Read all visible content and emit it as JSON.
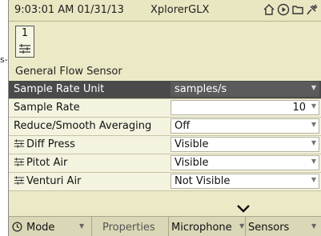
{
  "status_bar": {
    "time": "9:03:01 AM 01/31/13",
    "app_title": "XplorerGLX",
    "icons": [
      "home-icon",
      "play-icon",
      "folder-icon",
      "power-plug-icon"
    ]
  },
  "side_mark": "s-",
  "sensor": {
    "channel": "1",
    "icon": "flow-sensor-icon",
    "name": "General Flow Sensor"
  },
  "properties": [
    {
      "label": "Sample Rate Unit",
      "value": "samples/s",
      "selected": true
    },
    {
      "label": "Sample Rate",
      "value": "10",
      "align": "right"
    },
    {
      "label": "Reduce/Smooth Averaging",
      "value": "Off"
    },
    {
      "label": "Diff Press",
      "value": "Visible",
      "icon": "flow-sensor-icon"
    },
    {
      "label": "Pitot Air",
      "value": "Visible",
      "icon": "flow-sensor-icon"
    },
    {
      "label": "Venturi Air",
      "value": "Not Visible",
      "icon": "flow-sensor-icon"
    }
  ],
  "scroll_indicator": "chevron-down-icon",
  "toolbar": {
    "mode_label": "Mode",
    "properties_label": "Properties",
    "microphone_label": "Microphone",
    "sensors_label": "Sensors"
  },
  "colors": {
    "background": "#eceac6",
    "selected_row": "#4a4a4a",
    "toolbar": "#d9d7b6"
  }
}
